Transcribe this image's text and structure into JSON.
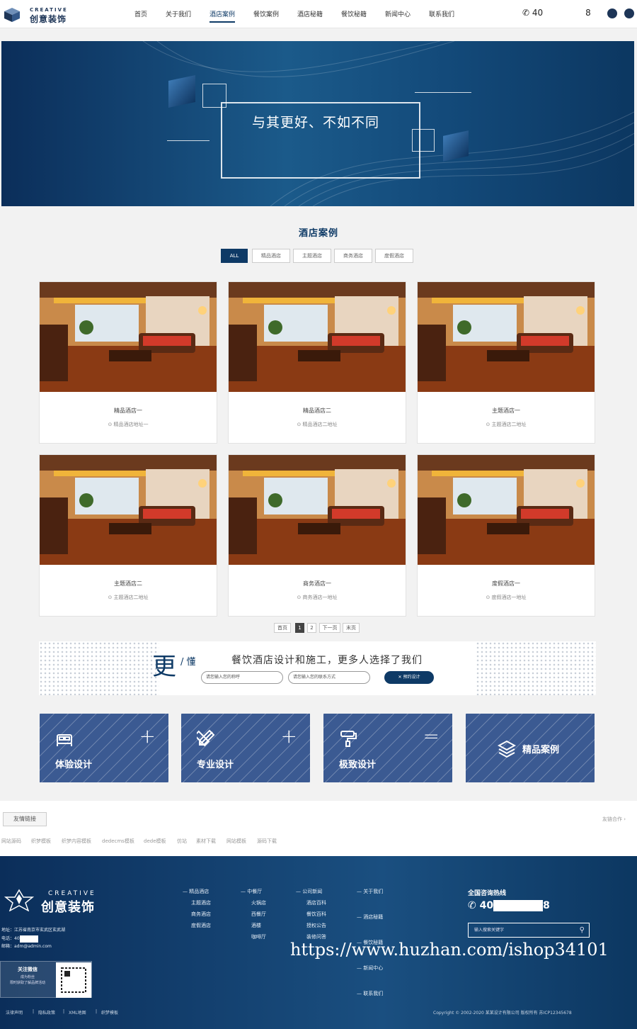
{
  "header": {
    "logo_en": "CREATIVE",
    "logo_cn": "创意装饰",
    "nav": [
      "首页",
      "关于我们",
      "酒店案例",
      "餐饮案例",
      "酒店秘籍",
      "餐饮秘籍",
      "新闻中心",
      "联系我们"
    ],
    "active_nav": "酒店案例",
    "phone_prefix": "40",
    "phone_suffix": "8"
  },
  "banner": {
    "slogan": "与其更好、不如不同"
  },
  "section": {
    "title": "酒店案例",
    "filters": [
      "ALL",
      "精品酒店",
      "主题酒店",
      "商务酒店",
      "度假酒店"
    ]
  },
  "cases": [
    {
      "title": "精品酒店一",
      "address": "精品酒店地址一"
    },
    {
      "title": "精品酒店二",
      "address": "精品酒店二地址"
    },
    {
      "title": "主题酒店一",
      "address": "主题酒店二地址"
    },
    {
      "title": "主题酒店二",
      "address": "主题酒店二地址"
    },
    {
      "title": "商务酒店一",
      "address": "商务酒店一地址"
    },
    {
      "title": "度假酒店一",
      "address": "度假酒店一地址"
    }
  ],
  "pagination": {
    "first": "首页",
    "pages": [
      "1",
      "2"
    ],
    "next": "下一页",
    "last": "末页",
    "current": "1"
  },
  "cta": {
    "big_char": "更",
    "small_char": "/ 懂",
    "text": "餐饮酒店设计和施工，更多人选择了我们",
    "name_placeholder": "请您输入您的称呼",
    "contact_placeholder": "请您输入您的联系方式",
    "button": "预约设计"
  },
  "features": [
    {
      "label": "体验设计",
      "icon": "bed-icon",
      "symbol": "+"
    },
    {
      "label": "专业设计",
      "icon": "pencil-ruler-icon",
      "symbol": "+"
    },
    {
      "label": "极致设计",
      "icon": "roller-icon",
      "symbol": "="
    },
    {
      "label": "精品案例",
      "icon": "layers-icon",
      "symbol": ""
    }
  ],
  "friend_links": {
    "tag": "友情链接",
    "more": "友链合作 ›",
    "links": [
      "网站源码",
      "织梦模板",
      "织梦内容模板",
      "dedecms模板",
      "dede模板",
      "仿站",
      "素材下载",
      "网站模板",
      "源码下载"
    ]
  },
  "footer": {
    "logo_en": "CREATIVE",
    "logo_cn": "创意装饰",
    "address": "地址：江苏省南京市玄武区玄武湖",
    "phone": "电话：40",
    "email": "邮箱：adm@admin.com",
    "wechat_title": "关注微信",
    "wechat_sub1": "成为粉丝",
    "wechat_sub2": "限时获取了解品牌活动",
    "col1": [
      "精品酒店",
      "主题酒店",
      "商务酒店",
      "度假酒店"
    ],
    "col2": [
      "中餐厅",
      "火锅店",
      "西餐厅",
      "酒楼",
      "咖啡厅"
    ],
    "col3": [
      "公司新闻",
      "酒店百科",
      "餐饮百科",
      "授权公告",
      "装修问答"
    ],
    "col4": [
      "关于我们",
      "酒店秘籍",
      "餐饮秘籍",
      "新闻中心",
      "联系我们"
    ],
    "hotline_title": "全国咨询热线",
    "hotline_prefix": "40",
    "hotline_suffix": "8",
    "search_placeholder": "输入搜索关键字",
    "watermark": "https://www.huzhan.com/ishop34101",
    "bottom_links": [
      "法律声明",
      "隐私政策",
      "XML地图",
      "织梦模板"
    ],
    "copyright": "Copyright © 2002-2020 某某设计有限公司 版权所有 苏ICP12345678"
  },
  "colors": {
    "primary": "#0e3a66",
    "feature_bg": "#3b5a92",
    "footer_bg": "#0b2e5a"
  }
}
